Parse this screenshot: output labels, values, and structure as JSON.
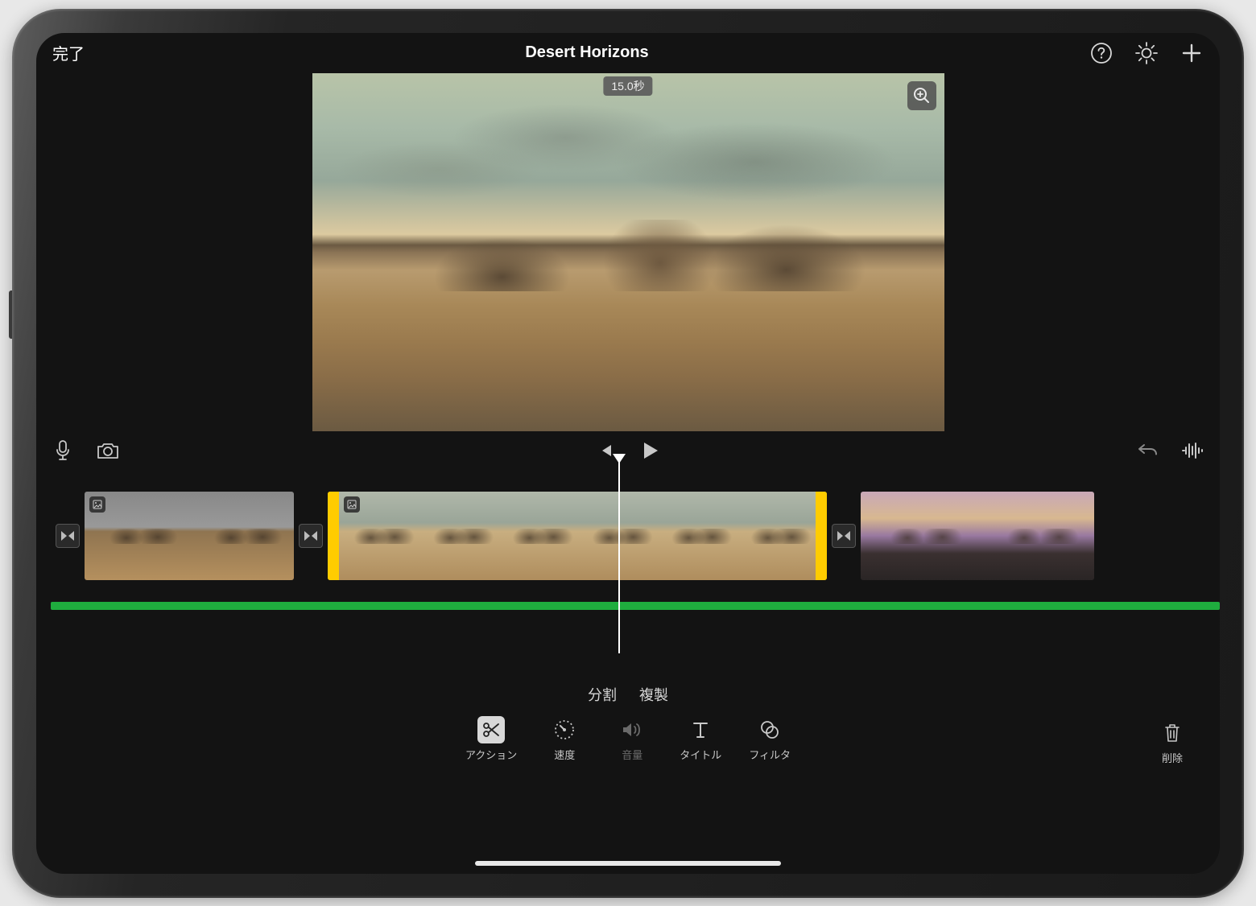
{
  "header": {
    "done_label": "完了",
    "title": "Desert Horizons"
  },
  "preview": {
    "duration_label": "15.0秒"
  },
  "actions": {
    "split": "分割",
    "duplicate": "複製"
  },
  "tools": {
    "action": "アクション",
    "speed": "速度",
    "volume": "音量",
    "title": "タイトル",
    "filter": "フィルタ",
    "delete": "削除"
  },
  "colors": {
    "selection": "#ffcc00",
    "audio": "#1fad3e"
  }
}
